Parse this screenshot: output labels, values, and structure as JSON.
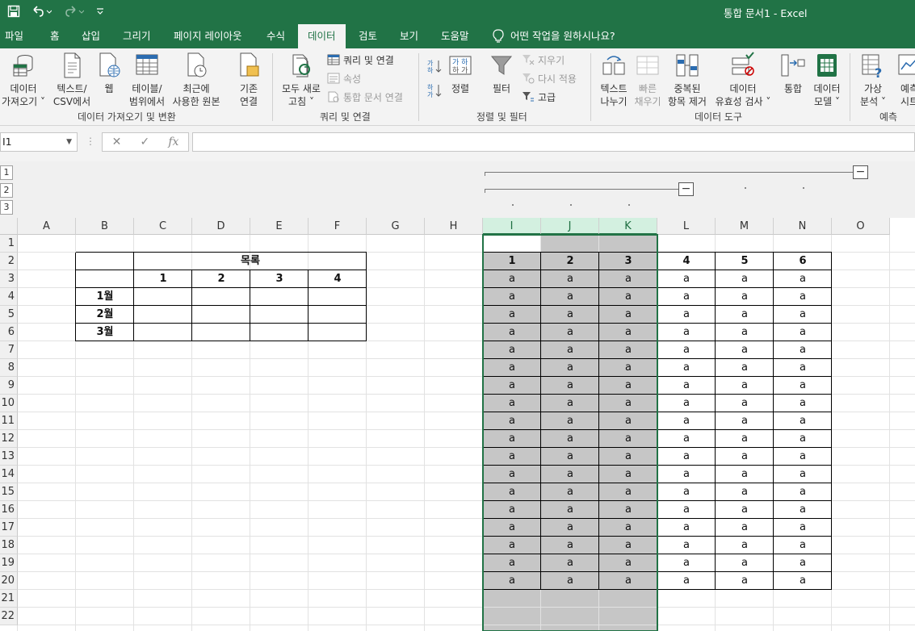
{
  "app": {
    "title": "통합 문서1  -  Excel",
    "quick_access": [
      "save-icon",
      "undo-icon",
      "redo-icon",
      "customize-icon"
    ]
  },
  "tabs": [
    "파일",
    "홈",
    "삽입",
    "그리기",
    "페이지 레이아웃",
    "수식",
    "데이터",
    "검토",
    "보기",
    "도움말"
  ],
  "active_tab": "데이터",
  "tell_me": "어떤 작업을 원하시나요?",
  "ribbon": {
    "groups": [
      "데이터 가져오기 및 변환",
      "쿼리 및 연결",
      "정렬 및 필터",
      "데이터 도구",
      "예측"
    ],
    "get_data": [
      "데이터",
      "가져오기 ˅"
    ],
    "text_csv": [
      "텍스트/",
      "CSV에서"
    ],
    "web": [
      "웹",
      ""
    ],
    "from_table": [
      "테이블/",
      "범위에서"
    ],
    "recent_sources": [
      "최근에",
      "사용한 원본"
    ],
    "existing": [
      "기존",
      "연결"
    ],
    "refresh_all": [
      "모두 새로",
      "고침 ˅"
    ],
    "queries": "쿼리 및 연결",
    "properties": "속성",
    "edit_links": "통합 문서 연결",
    "sort_asc": "힟",
    "sort_desc": "힟",
    "sort": "정렬",
    "filter": "필터",
    "clear": "지우기",
    "reapply": "다시 적용",
    "advanced": "고급",
    "text_to_columns": [
      "텍스트",
      "나누기"
    ],
    "flash_fill": [
      "빠른",
      "채우기"
    ],
    "remove_duplicates": [
      "중복된",
      "항목 제거"
    ],
    "validation": [
      "데이터",
      "유효성 검사 ˅"
    ],
    "consolidate": "통합",
    "data_model": [
      "데이터",
      "모델 ˅"
    ],
    "what_if": [
      "가상",
      "분석 ˅"
    ],
    "forecast": [
      "예측",
      "시트"
    ]
  },
  "formula_bar": {
    "name_box": "I1",
    "fx": "fx",
    "value": ""
  },
  "outline": {
    "levels": [
      "1",
      "2",
      "3"
    ],
    "collapse": "−"
  },
  "sheet": {
    "columns": [
      "A",
      "B",
      "C",
      "D",
      "E",
      "F",
      "G",
      "H",
      "I",
      "J",
      "K",
      "L",
      "M",
      "N",
      "O"
    ],
    "selected_columns": [
      "I",
      "J",
      "K"
    ],
    "rows": [
      "1",
      "2",
      "3",
      "4",
      "5",
      "6",
      "7",
      "8",
      "9",
      "10",
      "11",
      "12",
      "13",
      "14",
      "15",
      "16",
      "17",
      "18",
      "19",
      "20",
      "21",
      "22"
    ],
    "table1": {
      "title": "목록",
      "headers": [
        "1",
        "2",
        "3",
        "4"
      ],
      "row_labels": [
        "1월",
        "2월",
        "3월"
      ]
    },
    "table2": {
      "headers": [
        "1",
        "2",
        "3",
        "4",
        "5",
        "6"
      ],
      "cell_value": "a"
    }
  }
}
